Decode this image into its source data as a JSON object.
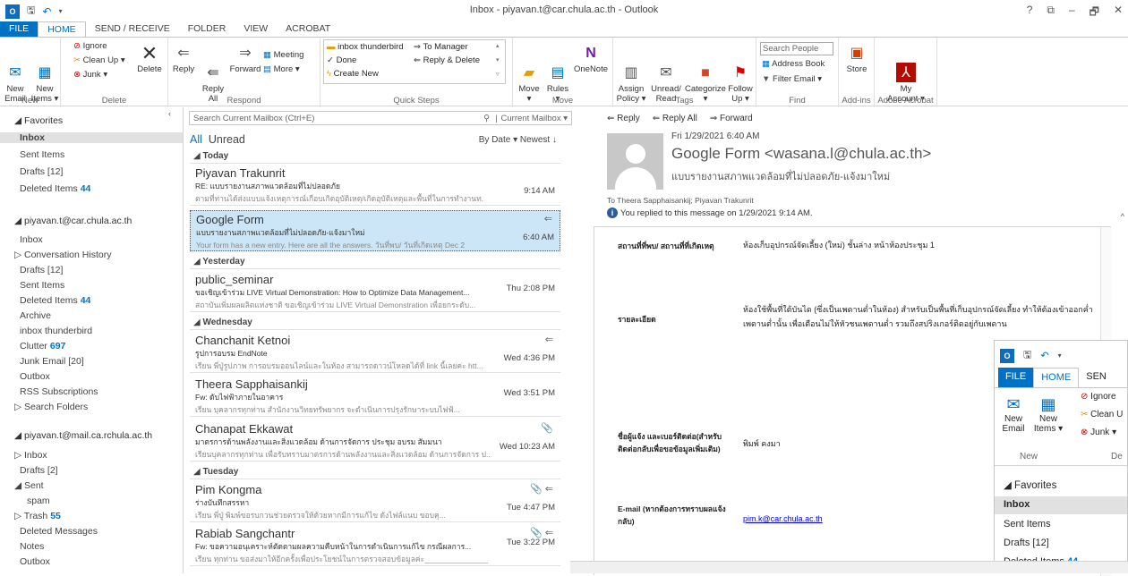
{
  "window": {
    "title": "Inbox - piyavan.t@car.chula.ac.th - Outlook",
    "qa_logo": "O",
    "controls": [
      "?",
      "⧉",
      "–",
      "🗗",
      "✕"
    ]
  },
  "tabs": [
    "FILE",
    "HOME",
    "SEND / RECEIVE",
    "FOLDER",
    "VIEW",
    "ACROBAT"
  ],
  "ribbon": {
    "new": {
      "email": "New\nEmail",
      "items": "New\nItems ▾",
      "label": "New"
    },
    "delete": {
      "ignore": "Ignore",
      "cleanup": "Clean Up ▾",
      "junk": "Junk ▾",
      "delete": "Delete",
      "label": "Delete"
    },
    "respond": {
      "reply": "Reply",
      "replyall": "Reply\nAll",
      "forward": "Forward",
      "meeting": "Meeting",
      "more": "More ▾",
      "label": "Respond"
    },
    "quicksteps": {
      "items": [
        "inbox thunderbird",
        "To Manager",
        "Done",
        "Reply & Delete",
        "Create New"
      ],
      "label": "Quick Steps"
    },
    "move": {
      "move": "Move\n▾",
      "rules": "Rules\n▾",
      "onenote": "OneNote",
      "label": "Move"
    },
    "tags": {
      "assign": "Assign\nPolicy ▾",
      "unread": "Unread/\nRead",
      "categorize": "Categorize\n▾",
      "follow": "Follow\nUp ▾",
      "label": "Tags"
    },
    "find": {
      "search_people": "Search People",
      "address_book": "Address Book",
      "filter_email": "Filter Email ▾",
      "label": "Find"
    },
    "addins": {
      "store": "Store",
      "label": "Add-ins"
    },
    "acrobat": {
      "account": "My\nAccount ▾",
      "label": "Adobe Acrobat"
    }
  },
  "nav": {
    "favorites_header": "◢ Favorites",
    "favorites": [
      {
        "label": "Inbox",
        "count": ""
      },
      {
        "label": "Sent Items",
        "count": ""
      },
      {
        "label": "Drafts [12]",
        "count": ""
      },
      {
        "label": "Deleted Items",
        "count": "44"
      }
    ],
    "account1_header": "◢ piyavan.t@car.chula.ac.th",
    "account1": [
      {
        "label": "Inbox",
        "count": ""
      },
      {
        "label": "▷ Conversation History",
        "count": ""
      },
      {
        "label": "Drafts [12]",
        "count": ""
      },
      {
        "label": "Sent Items",
        "count": ""
      },
      {
        "label": "Deleted Items",
        "count": "44"
      },
      {
        "label": "Archive",
        "count": ""
      },
      {
        "label": "inbox thunderbird",
        "count": ""
      },
      {
        "label": "Clutter",
        "count": "697"
      },
      {
        "label": "Junk Email [20]",
        "count": ""
      },
      {
        "label": "Outbox",
        "count": ""
      },
      {
        "label": "RSS Subscriptions",
        "count": ""
      },
      {
        "label": "▷ Search Folders",
        "count": ""
      }
    ],
    "account2_header": "◢ piyavan.t@mail.ca.rchula.ac.th",
    "account2": [
      {
        "label": "▷ Inbox",
        "count": ""
      },
      {
        "label": "Drafts [2]",
        "count": ""
      },
      {
        "label": "◢ Sent",
        "count": ""
      },
      {
        "label": "spam",
        "count": ""
      },
      {
        "label": "▷ Trash",
        "count": "55"
      },
      {
        "label": "Deleted Messages",
        "count": ""
      },
      {
        "label": "Notes",
        "count": ""
      },
      {
        "label": "Outbox",
        "count": ""
      }
    ]
  },
  "list": {
    "search_placeholder": "Search Current Mailbox (Ctrl+E)",
    "search_scope": "Current Mailbox ▾",
    "filter_all": "All",
    "filter_unread": "Unread",
    "sort": "By Date ▾   Newest ↓",
    "groups": [
      "◢ Today",
      "◢ Yesterday",
      "◢ Wednesday",
      "◢ Tuesday"
    ],
    "messages": [
      {
        "from": "Piyavan  Trakunrit",
        "subject": "RE: แบบรายงานสภาพแวดล้อมที่ไม่ปลอดภัย",
        "preview": "ตามที่ท่านได้ส่งแบบแจ้งเหตุการณ์เกือบเกิดอุบัติเหตุ/เกิดอุบัติเหตุและพื้นที่ในการทำงานท.",
        "time": "9:14 AM",
        "icon": ""
      },
      {
        "from": "Google Form",
        "subject": "แบบรายงานสภาพแวดล้อมที่ไม่ปลอดภัย-แจ้งมาใหม่",
        "preview": "Your form has a new entry. Here are all the answers. วันที่พบ/ วันที่เกิดเหตุ     Dec 2",
        "time": "6:40 AM",
        "icon": "⇐"
      },
      {
        "from": "public_seminar",
        "subject": "ขอเชิญเข้าร่วม LIVE Virtual Demonstration: How to Optimize Data Management...",
        "preview": "สถาบันเพิ่มผลผลิตแห่งชาติ ขอเชิญเข้าร่วม LIVE Virtual Demonstration เพื่อยกระดับ...",
        "time": "Thu 2:08 PM",
        "icon": ""
      },
      {
        "from": "Chanchanit Ketnoi",
        "subject": "รูปการอบรม EndNote",
        "preview": "เรียน พี่ปู่รูปภาพ การอบรมออนไลน์และในห้อง สามารถดาวน์โหลดได้ที่ link นี้เลยค่ะ htt...",
        "time": "Wed 4:36 PM",
        "icon": "⇐"
      },
      {
        "from": "Theera  Sapphaisankij",
        "subject": "Fw: ดับไฟฟ้าภายในอาคาร",
        "preview": "เรียน บุคลากรทุกท่าน        สำนักงานวิทยทรัพยากร จะดำเนินการปรุงรักษาระบบไฟฟ้...",
        "time": "Wed 3:51 PM",
        "icon": ""
      },
      {
        "from": "Chanapat Ekkawat",
        "subject": "มาตรการด้านพลังงานและสิ่งแวดล้อม ด้านการจัดการ ประชุม อบรม สัมมนา",
        "preview": "เรียนบุคลากรทุกท่าน เพื่อรับทราบมาตรการด้านพลังงานและสิ่งแวดล้อม ด้านการจัดการ ป...",
        "time": "Wed 10:23 AM",
        "icon": "📎"
      },
      {
        "from": "Pim  Kongma",
        "subject": "ร่างบันทึกสรรหา",
        "preview": "เรียน พี่ปู่       พิมพ์ขอรบกวนช่วยตรวจให้ด้วยหากมีการแก้ไข ดังไฟล์แนบ       ขอบคุ...",
        "time": "Tue 4:47 PM",
        "icon": "📎 ⇐"
      },
      {
        "from": "Rabiab  Sangchantr",
        "subject": "Fw: ขอความอนุเคราะห์ตัดตามผลความคืบหน้าในการดำเนินการแก้ไข กรณีผลการ...",
        "preview": "เรียน ทุกท่าน ขอส่งมาให้อีกครั้งเพื่อประโยชน์ในการตรวจสอบข้อมูลค่ะ_______________",
        "time": "Tue 3:22 PM",
        "icon": "📎 ⇐"
      }
    ]
  },
  "reading": {
    "actions": [
      "⇐ Reply",
      "⇐ Reply All",
      "⇒ Forward"
    ],
    "date": "Fri 1/29/2021 6:40 AM",
    "from": "Google Form <wasana.l@chula.ac.th>",
    "subject": "แบบรายงานสภาพแวดล้อมที่ไม่ปลอดภัย-แจ้งมาใหม่",
    "to": "To   Theera Sapphaisankij; Piyavan  Trakunrit",
    "info": "You replied to this message on 1/29/2021 9:14 AM.",
    "rows": [
      {
        "label": "สถานที่ที่พบ/ สถานที่ที่เกิดเหตุ",
        "value": "ห้องเก็บอุปกรณ์จัดเลี้ยง (ใหม่) ชั้นล่าง หน้าห้องประชุม 1"
      },
      {
        "label": "รายละเอียด",
        "value": "ห้องใช้พื้นที่ใต้บันได (ซึ่งเป็นเพดานต่ำในห้อง) สำหรับเป็นพื้นที่เก็บอุปกรณ์จัดเลี้ยง ทำให้ต้องเข้าออกค่ำเพดานต่ำนั้น เพื่อเตือนไม่ให้หัวชนเพดานต่ำ รวมถึงสปริงเกอร์ติดอยู่กับเพดาน"
      },
      {
        "label": "ชื่อผู้แจ้ง และเบอร์ติดต่อ(สำหรับติดต่อกลับเพื่อขอข้อมูลเพิ่มเติม)",
        "value": "พิมพ์ คงมา"
      },
      {
        "label": "E-mail (หากต้องการทราบผลแจ้งกลับ)",
        "value": "pim.k@car.chula.ac.th"
      }
    ]
  },
  "overlay": {
    "tabs": [
      "FILE",
      "HOME",
      "SEN"
    ],
    "ignore": "Ignore",
    "cleanup": "Clean U",
    "junk": "Junk ▾",
    "new_email": "New\nEmail",
    "new_items": "New\nItems ▾",
    "group_new": "New",
    "group_de": "De",
    "favorites": "◢ Favorites",
    "items": [
      {
        "label": "Inbox",
        "count": ""
      },
      {
        "label": "Sent Items",
        "count": ""
      },
      {
        "label": "Drafts [12]",
        "count": ""
      },
      {
        "label": "Deleted Items",
        "count": "44"
      }
    ]
  }
}
